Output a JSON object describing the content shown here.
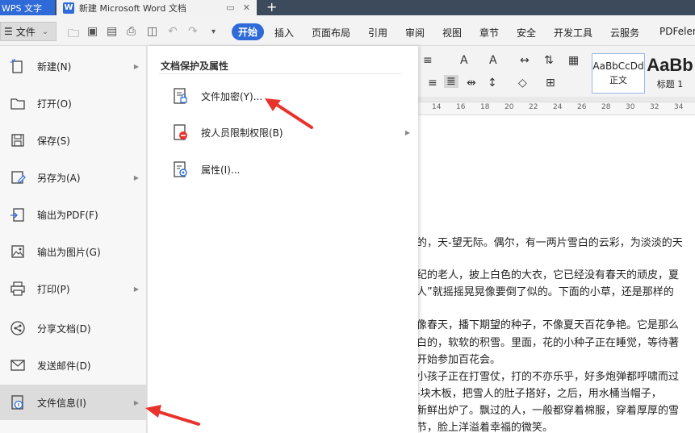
{
  "titlebar": {
    "app_tab": "WPS 文字",
    "doc_tab": "新建 Microsoft Word 文档",
    "add_tab": "+"
  },
  "toolbar": {
    "menu_label": "文件",
    "tabs": [
      "开始",
      "插入",
      "页面布局",
      "引用",
      "审阅",
      "视图",
      "章节",
      "安全",
      "开发工具",
      "云服务",
      "PDFeler"
    ]
  },
  "ribbon": {
    "styles": [
      {
        "sample": "AaBbCcDd",
        "name": "正文"
      },
      {
        "sample": "AaBb",
        "name": "标题 1"
      }
    ]
  },
  "ruler": {
    "ticks": [
      "14",
      "16",
      "18",
      "20",
      "22",
      "24",
      "26",
      "28",
      "30",
      "32",
      "34"
    ]
  },
  "left_menu": {
    "items": [
      {
        "label": "新建(N)",
        "icon": "new-doc-icon",
        "has_submenu": true
      },
      {
        "label": "打开(O)",
        "icon": "folder-icon",
        "has_submenu": false
      },
      {
        "label": "保存(S)",
        "icon": "save-icon",
        "has_submenu": false
      },
      {
        "label": "另存为(A)",
        "icon": "save-as-icon",
        "has_submenu": true
      },
      {
        "label": "输出为PDF(F)",
        "icon": "pdf-export-icon",
        "has_submenu": false
      },
      {
        "label": "输出为图片(G)",
        "icon": "image-export-icon",
        "has_submenu": false
      },
      {
        "label": "打印(P)",
        "icon": "print-icon",
        "has_submenu": true
      },
      {
        "label": "分享文档(D)",
        "icon": "share-icon",
        "has_submenu": false
      },
      {
        "label": "发送邮件(D)",
        "icon": "mail-icon",
        "has_submenu": false
      },
      {
        "label": "文件信息(I)",
        "icon": "file-info-icon",
        "has_submenu": true,
        "active": true
      }
    ]
  },
  "submenu": {
    "title": "文档保护及属性",
    "items": [
      {
        "label": "文件加密(Y)...",
        "icon": "file-encrypt-icon",
        "has_submenu": false
      },
      {
        "label": "按人员限制权限(B)",
        "icon": "restrict-permission-icon",
        "has_submenu": true
      },
      {
        "label": "属性(I)...",
        "icon": "properties-icon",
        "has_submenu": false
      }
    ]
  },
  "document": {
    "lines": [
      "的，天-望无际。偶尔，有一两片雪白的云彩，为淡淡的天",
      "纪的老人，披上白色的大衣，它已经没有春天的顽皮，夏",
      "人”就摇摇晃晃像要倒了似的。下面的小草，还是那样的",
      "像春天，播下期望的种子，不像夏天百花争艳。它是那么",
      "白的，软软的积雪。里面，花的小种子正在睡觉，等待著",
      "开始参加百花会。",
      "小孩子正在打雪仗，打的不亦乐乎，好多炮弹都呼啸而过",
      "-块木板，把雪人的肚子搭好，之后，用水桶当帽子，",
      "新鲜出炉了。飘过的人，一般都穿着棉服，穿着厚厚的雪",
      "节，脸上洋溢着幸福的微笑。"
    ]
  },
  "colors": {
    "accent": "#2f6bd8",
    "annotation": "#e8322b",
    "titlebar": "#3c4a5b"
  }
}
